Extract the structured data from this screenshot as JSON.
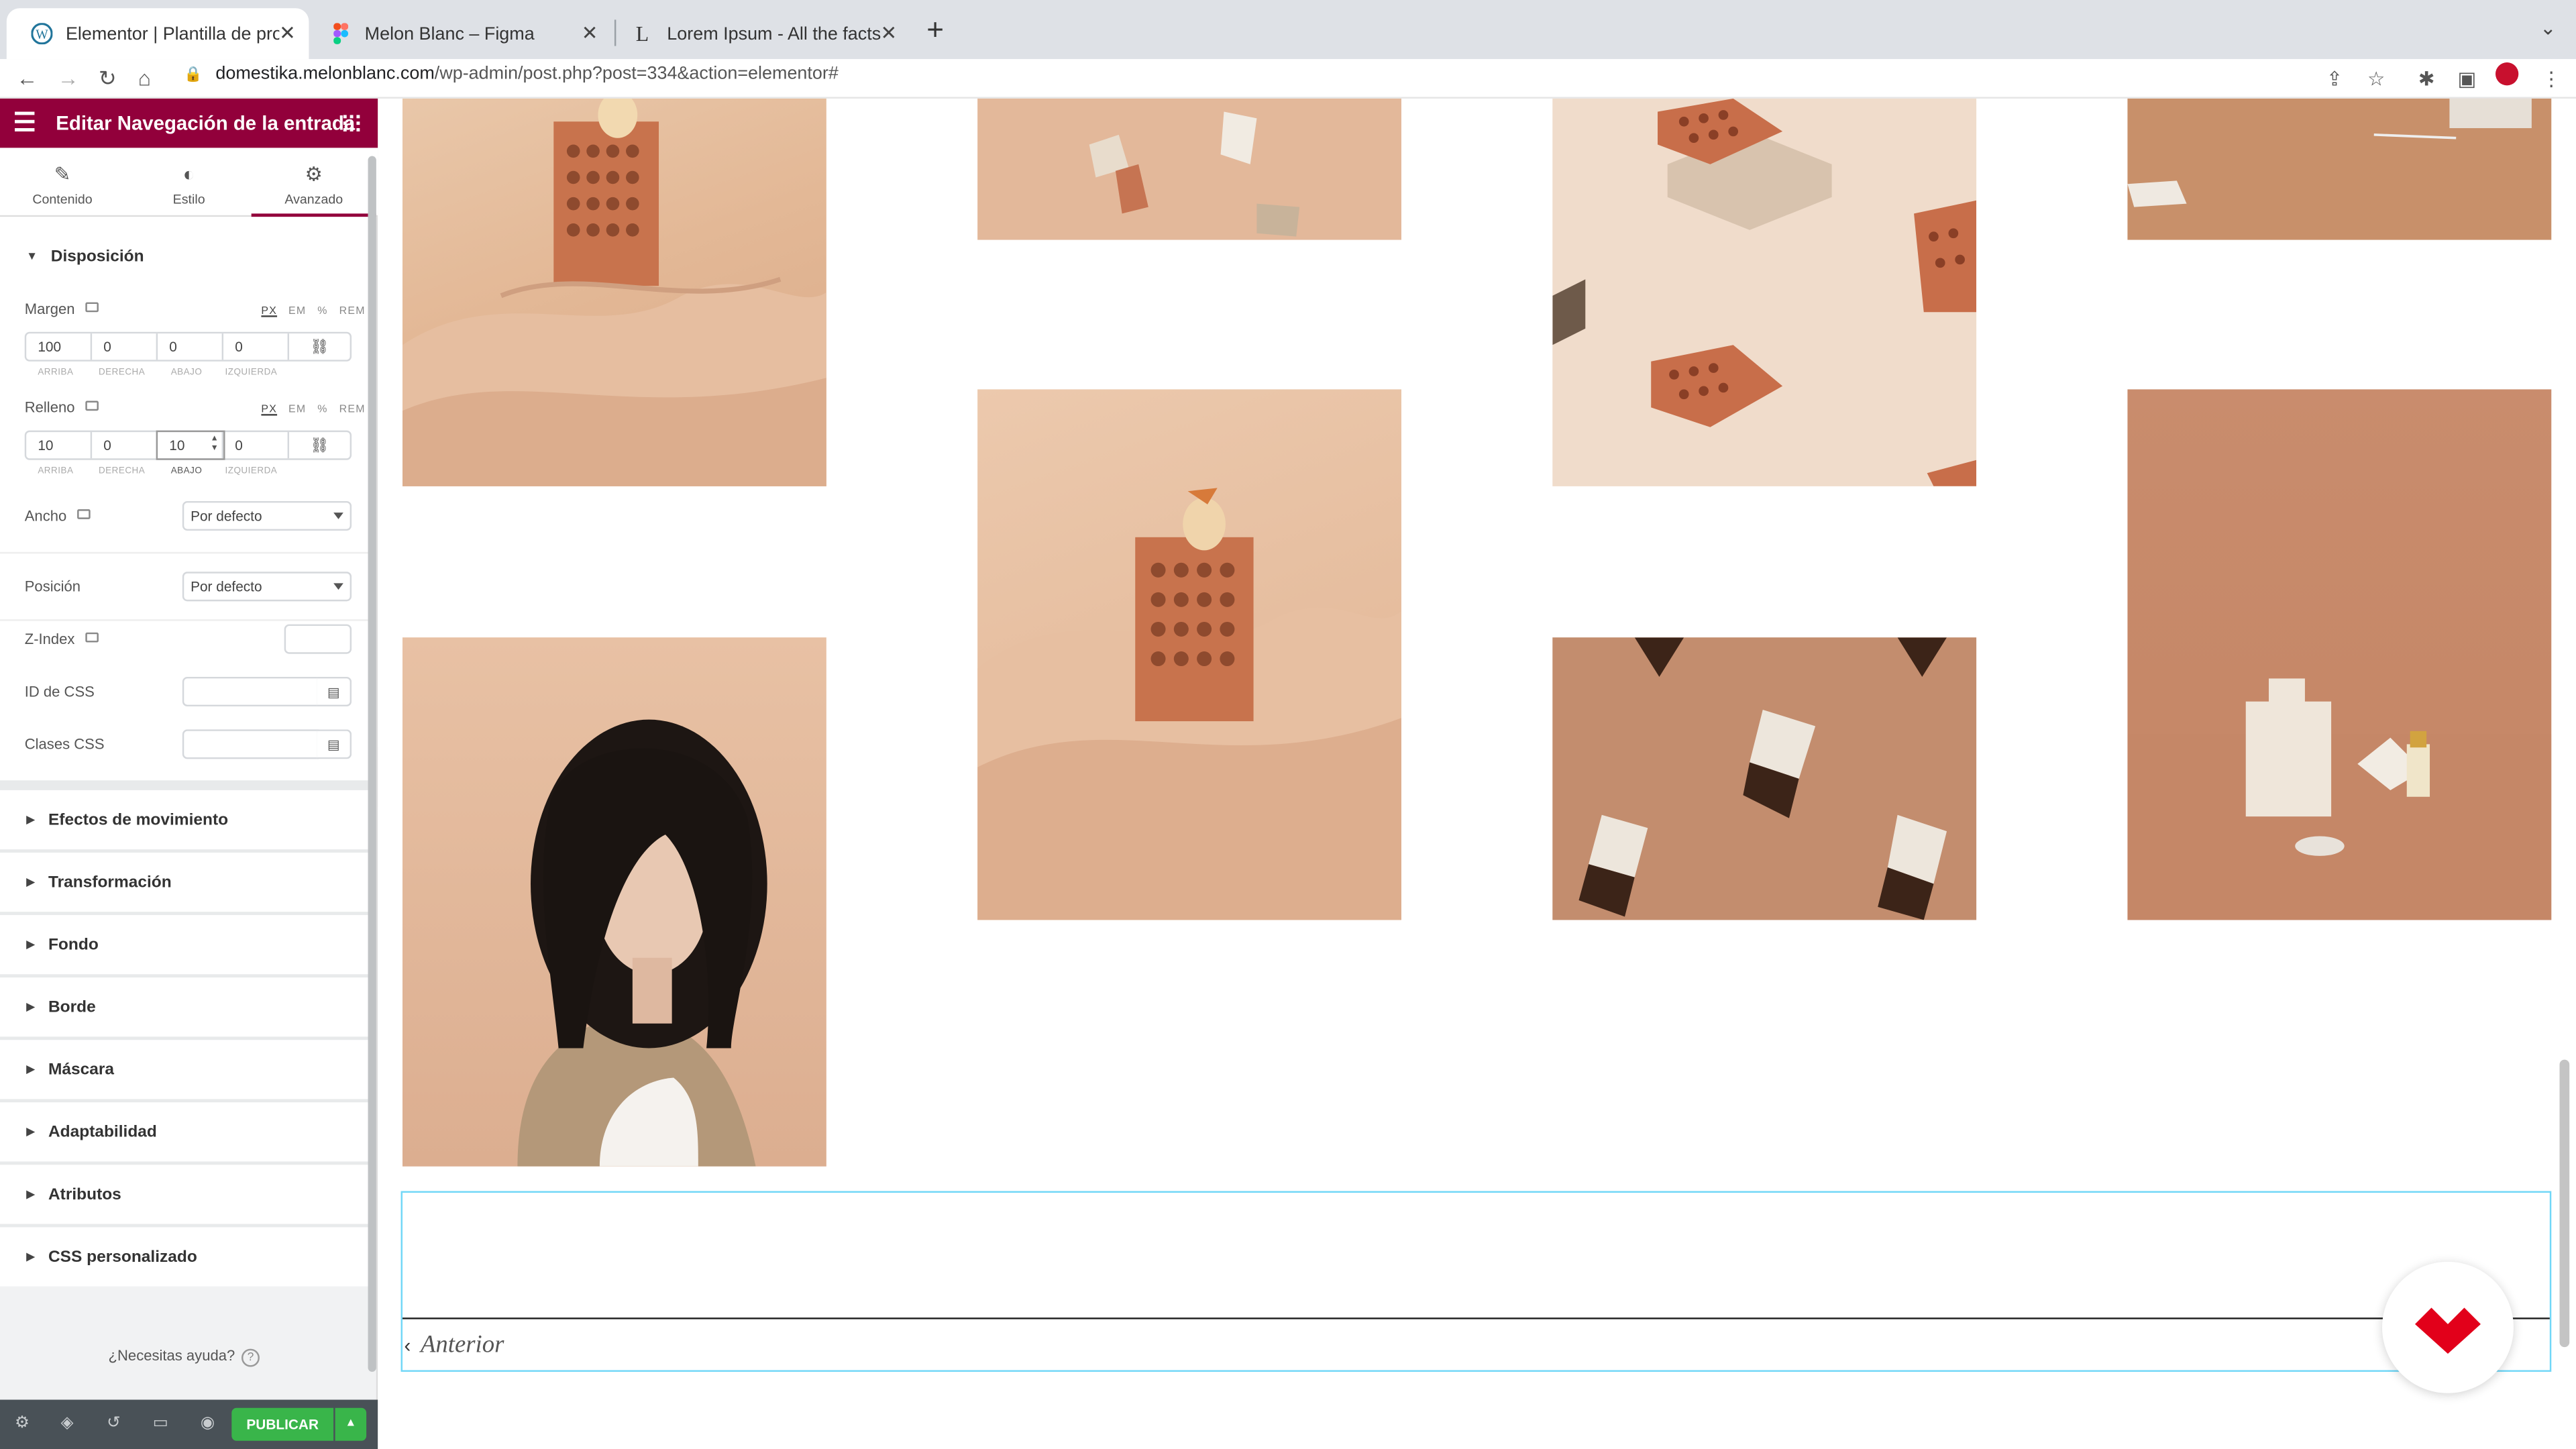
{
  "browser": {
    "tabs": [
      {
        "title": "Elementor | Plantilla de proyecto",
        "icon": "wordpress-icon"
      },
      {
        "title": "Melon Blanc – Figma",
        "icon": "figma-icon"
      },
      {
        "title": "Lorem Ipsum - All the facts - Li",
        "icon": "lipsum-icon"
      }
    ],
    "new_tab": "+",
    "url_domain": "domestika.melonblanc.com",
    "url_path": "/wp-admin/post.php?post=334&action=elementor#"
  },
  "sidebar": {
    "title": "Editar Navegación de la entrada",
    "tabs": [
      {
        "label": "Contenido",
        "icon": "✎"
      },
      {
        "label": "Estilo",
        "icon": "◐"
      },
      {
        "label": "Avanzado",
        "icon": "⚙"
      }
    ],
    "active_tab": "Avanzado",
    "section_open": "Disposición",
    "margin": {
      "label": "Margen",
      "units": [
        "PX",
        "EM",
        "%",
        "REM"
      ],
      "values": [
        "100",
        "0",
        "0",
        "0"
      ],
      "sides": [
        "ARRIBA",
        "DERECHA",
        "ABAJO",
        "IZQUIERDA"
      ]
    },
    "padding": {
      "label": "Relleno",
      "units": [
        "PX",
        "EM",
        "%",
        "REM"
      ],
      "values": [
        "10",
        "0",
        "10",
        "0"
      ],
      "sides": [
        "ARRIBA",
        "DERECHA",
        "ABAJO",
        "IZQUIERDA"
      ]
    },
    "width": {
      "label": "Ancho",
      "value": "Por defecto"
    },
    "position": {
      "label": "Posición",
      "value": "Por defecto"
    },
    "zindex": {
      "label": "Z-Index",
      "value": ""
    },
    "css_id": {
      "label": "ID de CSS",
      "value": ""
    },
    "css_classes": {
      "label": "Clases CSS",
      "value": ""
    },
    "sections": [
      "Efectos de movimiento",
      "Transformación",
      "Fondo",
      "Borde",
      "Máscara",
      "Adaptabilidad",
      "Atributos",
      "CSS personalizado"
    ],
    "help": "¿Necesitas ayuda?",
    "help_q": "?",
    "publish": "PUBLICAR"
  },
  "canvas": {
    "prev_label": "Anterior"
  },
  "colors": {
    "accent": "#92003b",
    "publish": "#39b54a",
    "selection": "#71d7f7"
  }
}
